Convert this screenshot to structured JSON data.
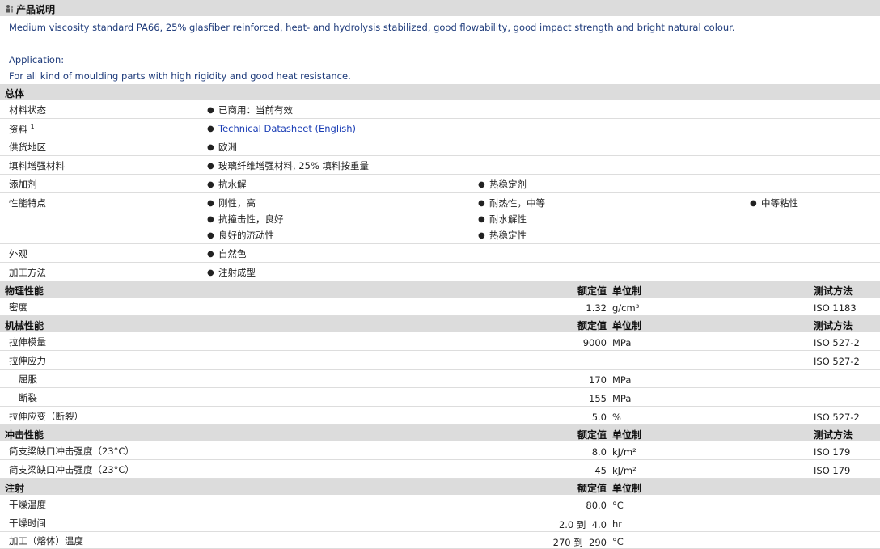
{
  "product_description": {
    "title": "产品说明",
    "text": "Medium viscosity standard PA66, 25% glasfiber reinforced, heat- and hydrolysis stabilized, good flowability, good impact strength and bright natural colour.",
    "application_label": "Application:",
    "application_text": "For all kind of moulding parts with high rigidity and good heat resistance."
  },
  "general": {
    "title": "总体",
    "material_status": {
      "label": "材料状态",
      "value": "已商用：当前有效"
    },
    "documents": {
      "label": "资料",
      "sup": "1",
      "link": "Technical Datasheet (English)"
    },
    "availability": {
      "label": "供货地区",
      "value": "欧洲"
    },
    "filler": {
      "label": "填料增强材料",
      "value": "玻璃纤维增强材料, 25% 填料按重量"
    },
    "additives": {
      "label": "添加剂",
      "values": [
        "抗水解",
        "热稳定剂"
      ]
    },
    "features": {
      "label": "性能特点",
      "values": [
        "刚性，高",
        "耐热性，中等",
        "中等粘性",
        "抗撞击性，良好",
        "耐水解性",
        "良好的流动性",
        "热稳定性"
      ]
    },
    "appearance": {
      "label": "外观",
      "value": "自然色"
    },
    "processing": {
      "label": "加工方法",
      "value": "注射成型"
    }
  },
  "columns": {
    "nominal": "额定值",
    "unit": "单位制",
    "method": "测试方法"
  },
  "physical": {
    "title": "物理性能",
    "rows": [
      {
        "label": "密度",
        "value": "1.32",
        "unit": "g/cm³",
        "method": "ISO 1183"
      }
    ]
  },
  "mechanical": {
    "title": "机械性能",
    "rows": [
      {
        "label": "拉伸模量",
        "value": "9000",
        "unit": "MPa",
        "method": "ISO 527-2"
      },
      {
        "label": "拉伸应力",
        "value": "",
        "unit": "",
        "method": "ISO 527-2"
      },
      {
        "label": "屈服",
        "value": "170",
        "unit": "MPa",
        "method": ""
      },
      {
        "label": "断裂",
        "value": "155",
        "unit": "MPa",
        "method": ""
      },
      {
        "label": "拉伸应变（断裂）",
        "value": "5.0",
        "unit": "%",
        "method": "ISO 527-2"
      }
    ]
  },
  "impact": {
    "title": "冲击性能",
    "rows": [
      {
        "label": "简支梁缺口冲击强度（23°C）",
        "value": "8.0",
        "unit": "kJ/m²",
        "method": "ISO 179"
      },
      {
        "label": "简支梁缺口冲击强度（23°C）",
        "value": "45",
        "unit": "kJ/m²",
        "method": "ISO 179"
      }
    ]
  },
  "injection": {
    "title": "注射",
    "rows": [
      {
        "label": "干燥温度",
        "value": "80.0",
        "unit": "°C"
      },
      {
        "label": "干燥时间",
        "value": "2.0 到  4.0",
        "unit": "hr"
      },
      {
        "label": "加工（熔体）温度",
        "value": "270 到  290",
        "unit": "°C"
      }
    ]
  }
}
